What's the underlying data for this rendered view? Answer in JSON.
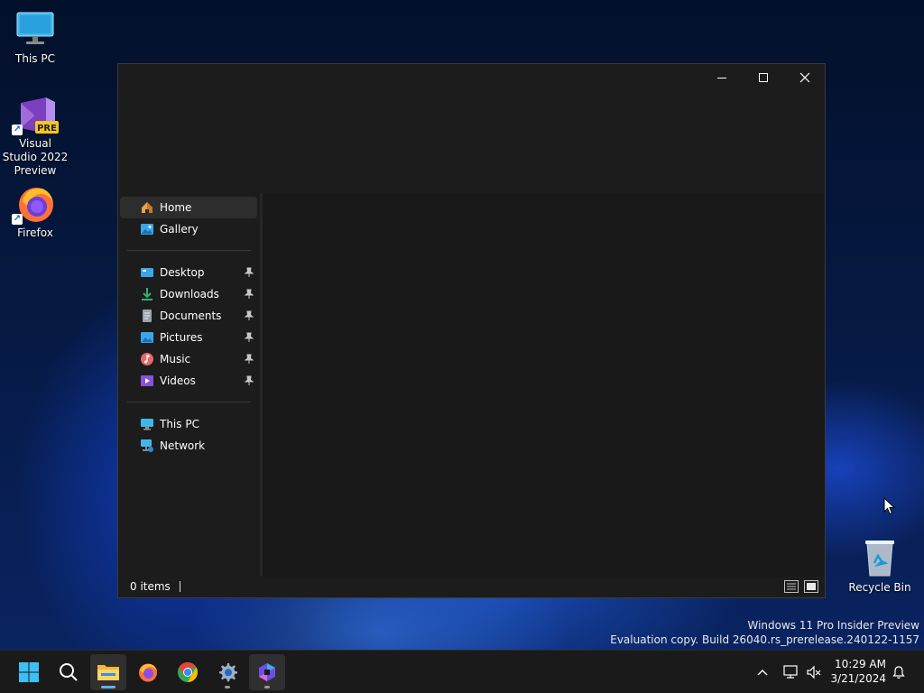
{
  "desktop": {
    "icons": [
      {
        "label": "This PC"
      },
      {
        "label": "Visual Studio 2022 Preview",
        "badge": "PRE"
      },
      {
        "label": "Firefox"
      },
      {
        "label": "Recycle Bin"
      }
    ]
  },
  "window": {
    "nav": {
      "home": "Home",
      "gallery": "Gallery",
      "quick_access": [
        {
          "label": "Desktop",
          "icon": "desktop-folder-icon"
        },
        {
          "label": "Downloads",
          "icon": "download-arrow-icon"
        },
        {
          "label": "Documents",
          "icon": "document-icon"
        },
        {
          "label": "Pictures",
          "icon": "pictures-icon"
        },
        {
          "label": "Music",
          "icon": "music-icon"
        },
        {
          "label": "Videos",
          "icon": "video-icon"
        }
      ],
      "this_pc": "This PC",
      "network": "Network"
    },
    "status": {
      "items": "0 items"
    }
  },
  "watermark": {
    "line1": "Windows 11 Pro Insider Preview",
    "line2": "Evaluation copy. Build 26040.rs_prerelease.240122-1157"
  },
  "taskbar": {
    "time": "10:29 AM",
    "date": "3/21/2024"
  },
  "colors": {
    "accent": "#5fb2f2",
    "window_bg": "#1c1c1c",
    "taskbar_bg": "#1a1a1a"
  }
}
